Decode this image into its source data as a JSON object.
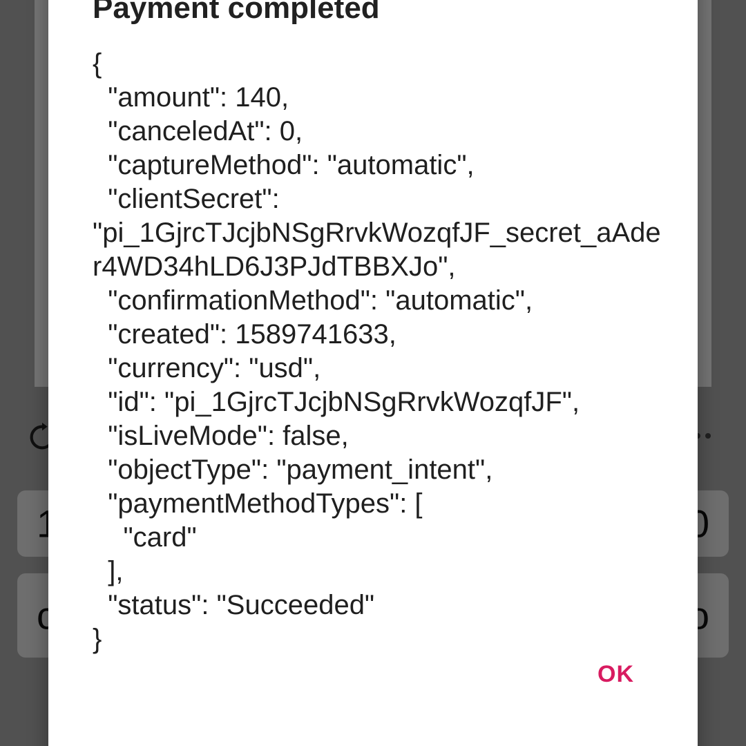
{
  "background": {
    "field1": {
      "left_text": "1",
      "right_text": "0"
    },
    "field2": {
      "left_text": "c",
      "right_text": "o"
    }
  },
  "dialog": {
    "title": "Payment completed",
    "body": "{\n  \"amount\": 140,\n  \"canceledAt\": 0,\n  \"captureMethod\": \"automatic\",\n  \"clientSecret\":\n\"pi_1GjrcTJcjbNSgRrvkWozqfJF_secret_aAder4WD34hLD6J3PJdTBBXJo\",\n  \"confirmationMethod\": \"automatic\",\n  \"created\": 1589741633,\n  \"currency\": \"usd\",\n  \"id\": \"pi_1GjrcTJcjbNSgRrvkWozqfJF\",\n  \"isLiveMode\": false,\n  \"objectType\": \"payment_intent\",\n  \"paymentMethodTypes\": [\n    \"card\"\n  ],\n  \"status\": \"Succeeded\"\n}",
    "ok_label": "OK"
  },
  "colors": {
    "accent": "#d81b60",
    "scrim": "rgba(0,0,0,0.52)"
  },
  "icons": {
    "refresh": "refresh-icon",
    "more": "more-horizontal-icon"
  }
}
